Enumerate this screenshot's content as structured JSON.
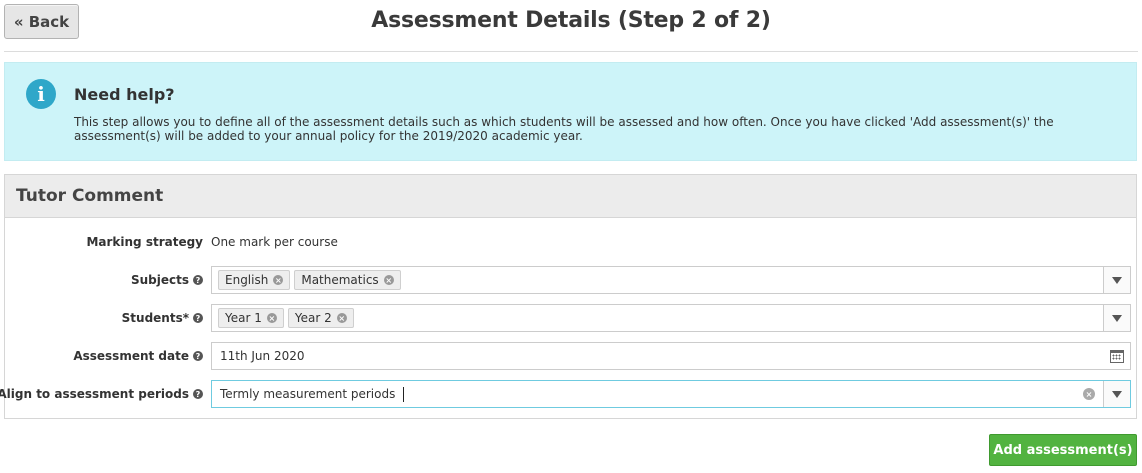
{
  "header": {
    "back_label": "« Back",
    "title": "Assessment Details (Step 2 of 2)"
  },
  "help": {
    "icon": "info-icon",
    "title": "Need help?",
    "text": "This step allows you to define all of the assessment details such as which students will be assessed and how often. Once you have clicked 'Add assessment(s)' the assessment(s) will be added to your annual policy for the 2019/2020 academic year."
  },
  "panel": {
    "title": "Tutor Comment",
    "marking_strategy": {
      "label": "Marking strategy",
      "value": "One mark per course"
    },
    "subjects": {
      "label": "Subjects",
      "tags": [
        "English",
        "Mathematics"
      ]
    },
    "students": {
      "label": "Students*",
      "tags": [
        "Year 1",
        "Year 2"
      ]
    },
    "assessment_date": {
      "label": "Assessment date",
      "value": "11th Jun 2020"
    },
    "align_periods": {
      "label": "Align to assessment periods",
      "value": "Termly measurement periods"
    }
  },
  "actions": {
    "submit_label": "Add assessment(s)"
  },
  "colors": {
    "help_bg": "#cdf4f9",
    "info_icon": "#2fa7c9",
    "submit_bg": "#52b340",
    "active_border": "#6fcbe0"
  }
}
